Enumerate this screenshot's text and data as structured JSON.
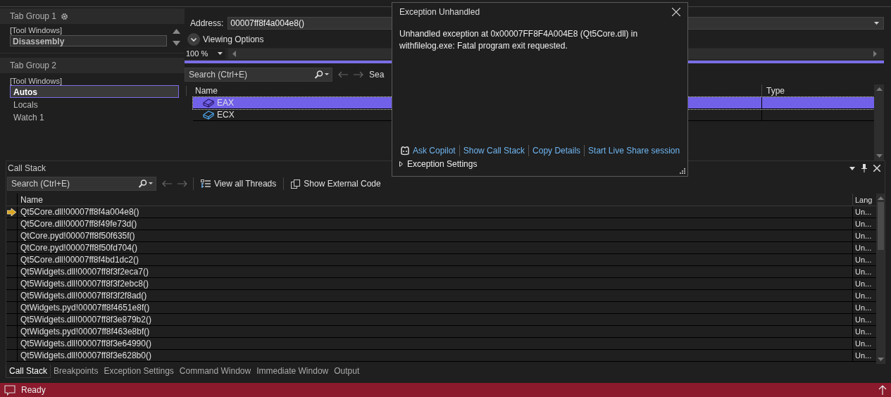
{
  "tab_group_1": {
    "title": "Tab Group 1",
    "category": "[Tool Windows]",
    "items": [
      {
        "label": "Disassembly",
        "selected": true
      }
    ]
  },
  "tab_group_2": {
    "title": "Tab Group 2",
    "category": "[Tool Windows]",
    "items": [
      {
        "label": "Autos",
        "selected": true
      },
      {
        "label": "Locals",
        "selected": false
      },
      {
        "label": "Watch 1",
        "selected": false
      }
    ]
  },
  "disassembly": {
    "address_label": "Address:",
    "address": "00007ff8f4a004e8()",
    "viewing_options": "Viewing Options",
    "zoom": "100 %"
  },
  "autos": {
    "search_placeholder": "Search (Ctrl+E)",
    "search_depth": "Sea",
    "columns": [
      "Name",
      "Type"
    ],
    "rows": [
      {
        "name": "EAX",
        "selected": true
      },
      {
        "name": "ECX",
        "selected": false
      }
    ]
  },
  "call_stack": {
    "title": "Call Stack",
    "search_placeholder": "Search (Ctrl+E)",
    "toolbar": [
      "View all Threads",
      "Show External Code"
    ],
    "columns": [
      "Name",
      "Lang"
    ],
    "rows": [
      {
        "name": "Qt5Core.dll!00007ff8f4a004e8()",
        "language": "Un...",
        "current": true
      },
      {
        "name": "Qt5Core.dll!00007ff8f49fe73d()",
        "language": "Un...",
        "current": false
      },
      {
        "name": "QtCore.pyd!00007ff8f50f635f()",
        "language": "Un...",
        "current": false
      },
      {
        "name": "QtCore.pyd!00007ff8f50fd704()",
        "language": "Un...",
        "current": false
      },
      {
        "name": "Qt5Core.dll!00007ff8f4bd1dc2()",
        "language": "Un...",
        "current": false
      },
      {
        "name": "Qt5Widgets.dll!00007ff8f3f2eca7()",
        "language": "Un...",
        "current": false
      },
      {
        "name": "Qt5Widgets.dll!00007ff8f3f2ebc8()",
        "language": "Un...",
        "current": false
      },
      {
        "name": "Qt5Widgets.dll!00007ff8f3f2f8ad()",
        "language": "Un...",
        "current": false
      },
      {
        "name": "QtWidgets.pyd!00007ff8f4651e8f()",
        "language": "Un...",
        "current": false
      },
      {
        "name": "Qt5Widgets.dll!00007ff8f3e879b2()",
        "language": "Un...",
        "current": false
      },
      {
        "name": "QtWidgets.pyd!00007ff8f463e8bf()",
        "language": "Un...",
        "current": false
      },
      {
        "name": "Qt5Widgets.dll!00007ff8f3e64990()",
        "language": "Un...",
        "current": false
      },
      {
        "name": "Qt5Widgets.dll!00007ff8f3e628b0()",
        "language": "Un...",
        "current": false
      }
    ]
  },
  "bottom_tabs": [
    {
      "label": "Call Stack",
      "selected": true
    },
    {
      "label": "Breakpoints",
      "selected": false
    },
    {
      "label": "Exception Settings",
      "selected": false
    },
    {
      "label": "Command Window",
      "selected": false
    },
    {
      "label": "Immediate Window",
      "selected": false
    },
    {
      "label": "Output",
      "selected": false
    }
  ],
  "status_bar": {
    "text": "Ready"
  },
  "exception_dialog": {
    "title": "Exception Unhandled",
    "message": "Unhandled exception at 0x00007FF8F4A004E8 (Qt5Core.dll) in withfilelog.exe: Fatal program exit requested.",
    "actions": [
      "Ask Copilot",
      "Show Call Stack",
      "Copy Details",
      "Start Live Share session"
    ],
    "settings": "Exception Settings"
  }
}
